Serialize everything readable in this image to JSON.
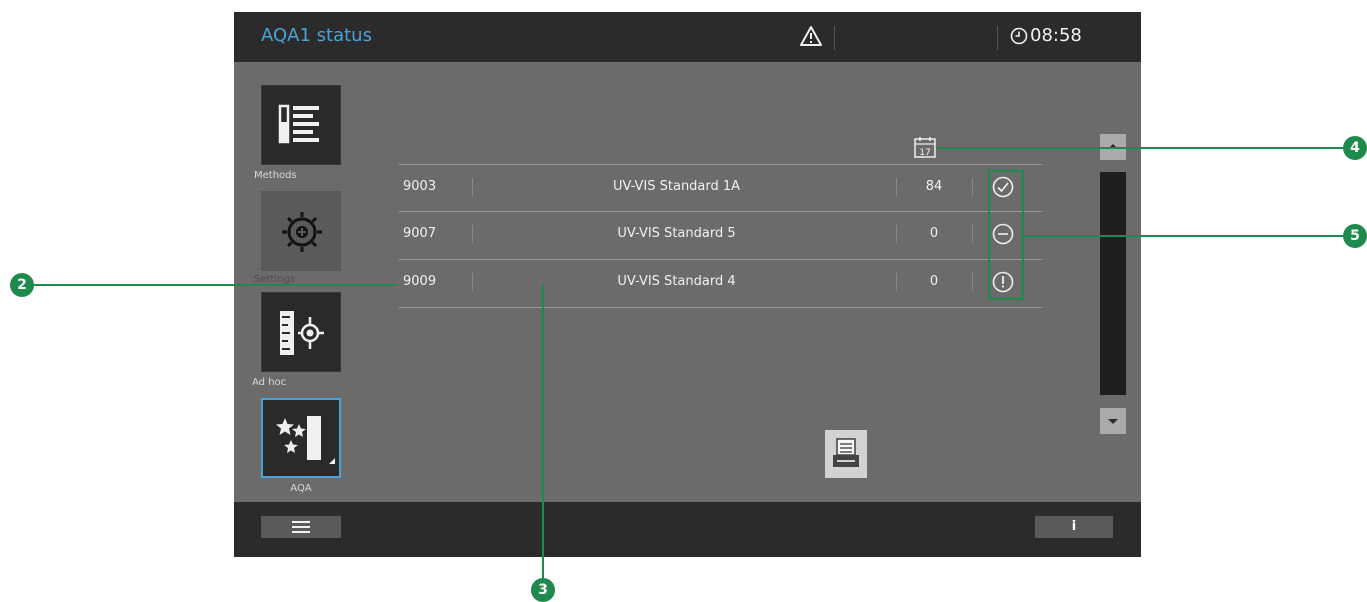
{
  "header": {
    "title": "AQA1 status",
    "time": "08:58",
    "warning_icon": "warning-triangle-icon",
    "clock_icon": "clock-icon"
  },
  "nav": {
    "methods": "Methods",
    "settings": "Settings",
    "adhoc": "Ad hoc",
    "aqa": "AQA"
  },
  "table": {
    "header_icon": "calendar-icon",
    "calendar_day": "17",
    "rows": [
      {
        "id": "9003",
        "name": "UV-VIS Standard 1A",
        "count": "84",
        "status": "check-circle-icon"
      },
      {
        "id": "9007",
        "name": "UV-VIS Standard 5",
        "count": "0",
        "status": "minus-circle-icon"
      },
      {
        "id": "9009",
        "name": "UV-VIS Standard 4",
        "count": "0",
        "status": "exclamation-circle-icon"
      }
    ]
  },
  "footer": {
    "info_label": "i",
    "menu_icon": "hamburger-menu-icon"
  },
  "callouts": {
    "c2": "2",
    "c3": "3",
    "c4": "4",
    "c5": "5"
  },
  "colors": {
    "accent": "#4aa3d8",
    "callout": "#1e8a4d",
    "bar": "#2b2b2b",
    "panel": "#6b6b6b"
  }
}
